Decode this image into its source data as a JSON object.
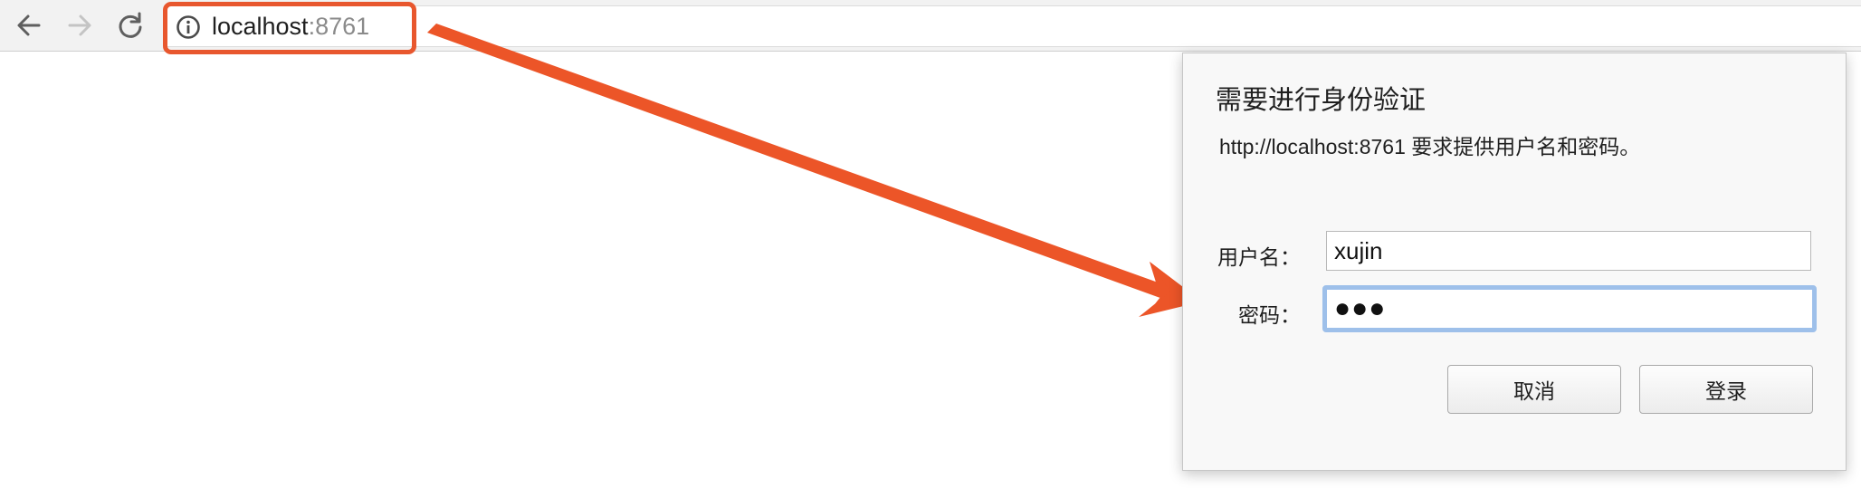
{
  "browser": {
    "back_icon": "arrow-left-icon",
    "forward_icon": "arrow-right-icon",
    "reload_icon": "reload-icon",
    "info_icon": "info-circle-icon",
    "url_host": "localhost",
    "url_port": ":8761",
    "highlight_color": "#e8572e"
  },
  "dialog": {
    "title": "需要进行身份验证",
    "message": "http://localhost:8761 要求提供用户名和密码。",
    "username_label": "用户名：",
    "username_value": "xujin",
    "password_label": "密码：",
    "password_display": "●●●",
    "cancel_label": "取消",
    "login_label": "登录",
    "focus_color": "#9ec0ea"
  }
}
